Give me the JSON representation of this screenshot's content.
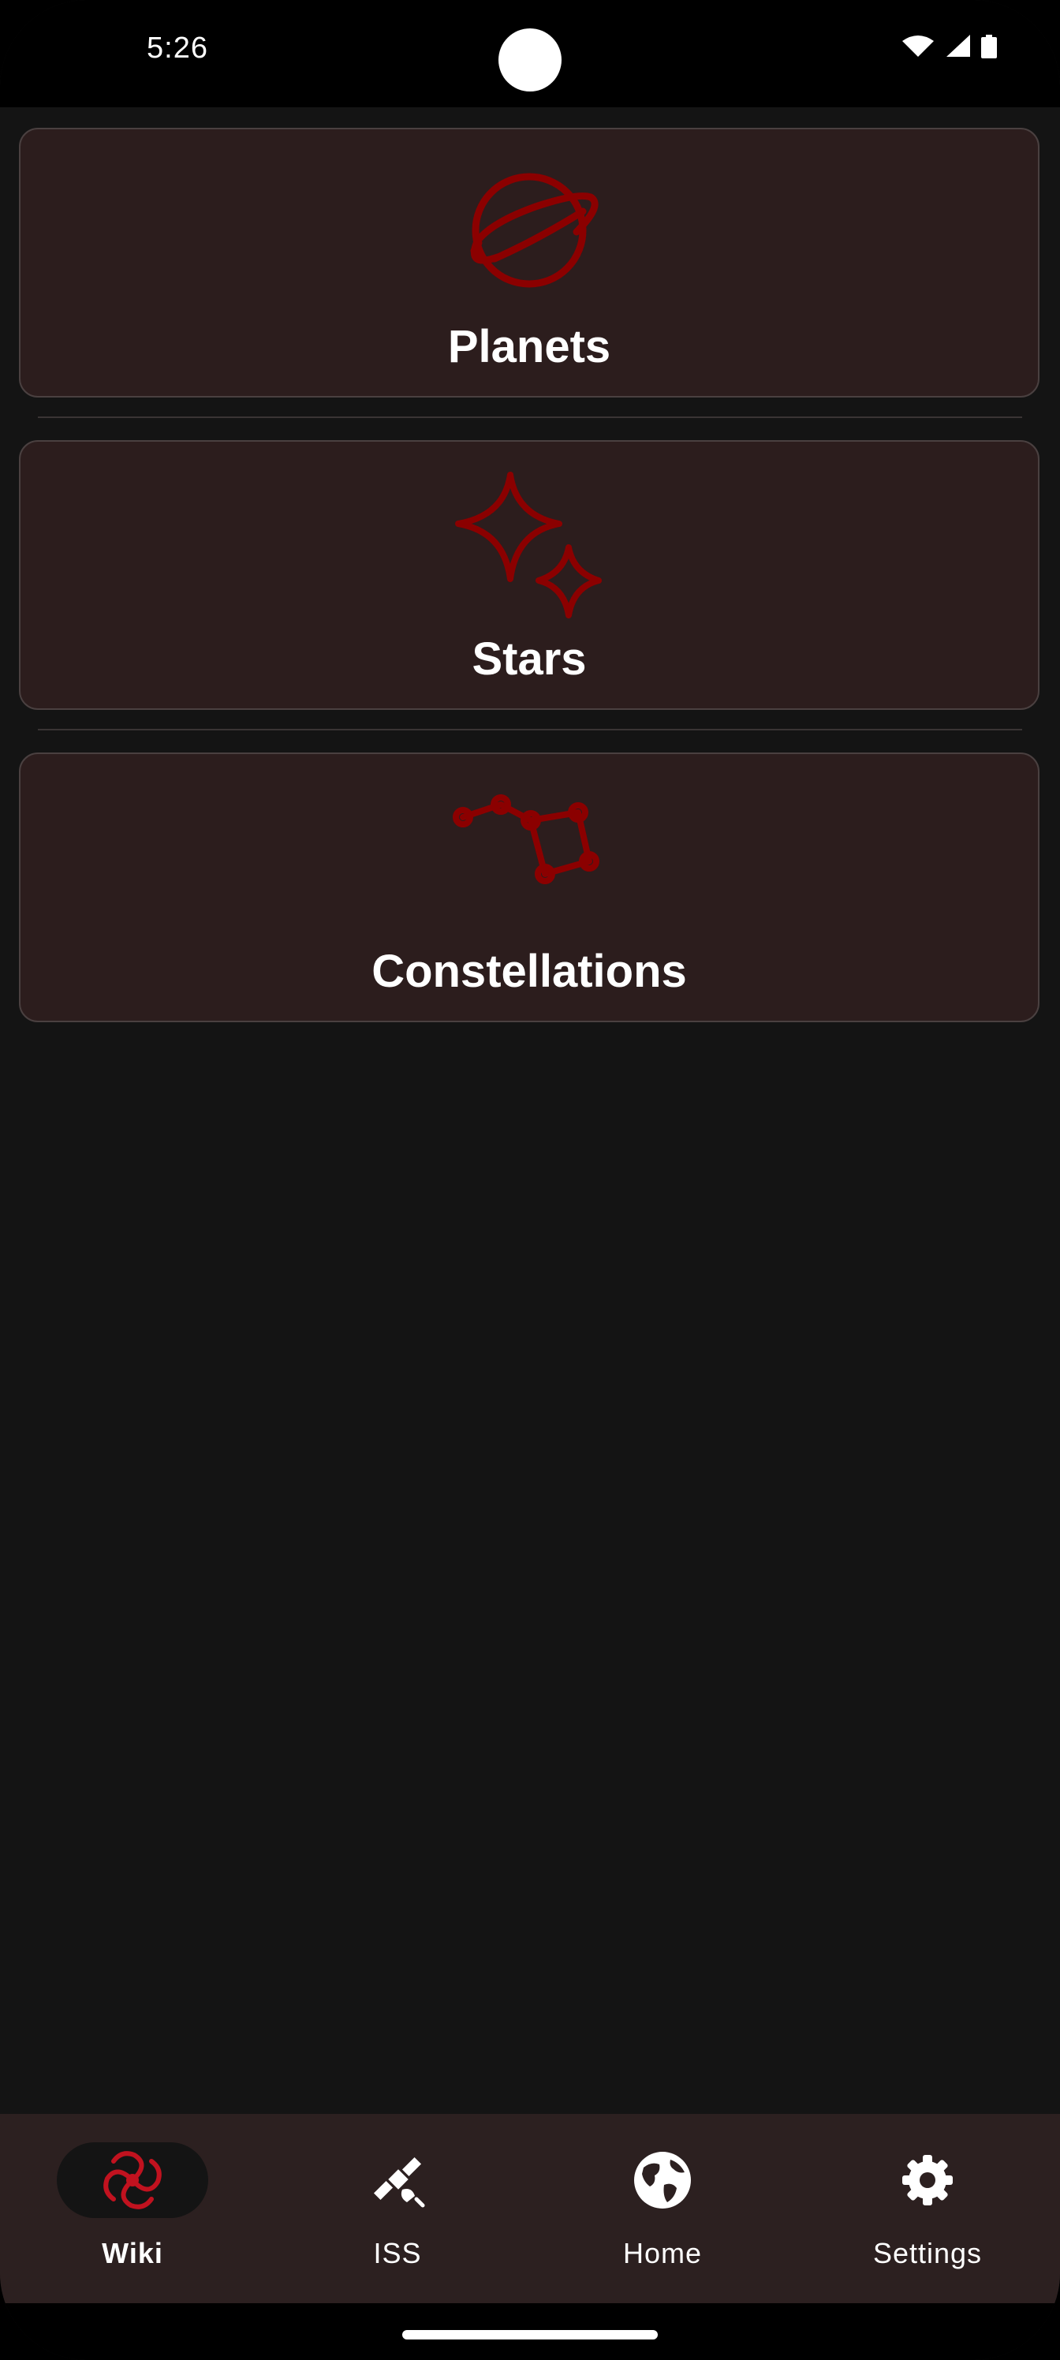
{
  "status_bar": {
    "time": "5:26",
    "icons": [
      "wifi-icon",
      "signal-icon",
      "battery-icon"
    ]
  },
  "categories": [
    {
      "label": "Planets",
      "icon": "planet-icon"
    },
    {
      "label": "Stars",
      "icon": "sparkle-stars-icon"
    },
    {
      "label": "Constellations",
      "icon": "constellation-icon"
    }
  ],
  "bottom_nav": {
    "active": "Wiki",
    "items": [
      {
        "label": "Wiki",
        "icon": "galaxy-icon"
      },
      {
        "label": "ISS",
        "icon": "satellite-icon"
      },
      {
        "label": "Home",
        "icon": "globe-icon"
      },
      {
        "label": "Settings",
        "icon": "gear-icon"
      }
    ]
  },
  "colors": {
    "background": "#141414",
    "card_background": "#2c1d1d",
    "card_border": "#4a4040",
    "accent": "#8b0000",
    "nav_background": "#2c2020",
    "text": "#ffffff"
  }
}
